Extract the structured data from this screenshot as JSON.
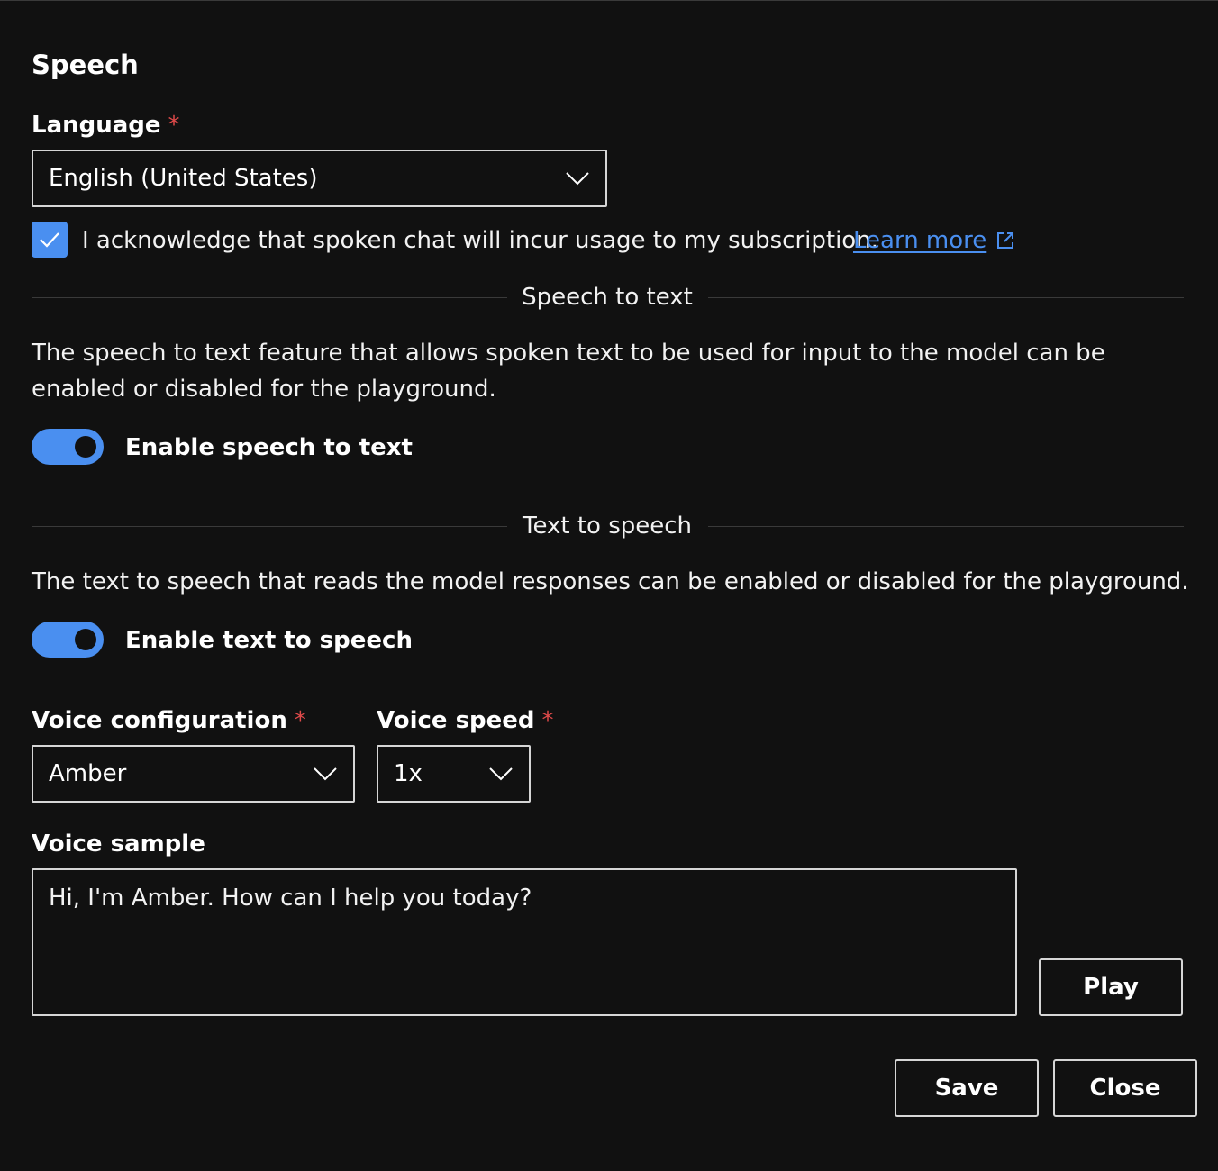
{
  "dialog": {
    "title": "Speech"
  },
  "language": {
    "label": "Language",
    "required_mark": "*",
    "selected": "English (United States)"
  },
  "acknowledge": {
    "checked": true,
    "text": "I acknowledge that spoken chat will incur usage to my subscription.",
    "link_text": "Learn more"
  },
  "speech_to_text": {
    "section_title": "Speech to text",
    "description": "The speech to text feature that allows spoken text to be used for input to the model can be enabled or disabled for the playground.",
    "toggle_label": "Enable speech to text",
    "enabled": true
  },
  "text_to_speech": {
    "section_title": "Text to speech",
    "description": "The text to speech that reads the model responses can be enabled or disabled for the playground.",
    "toggle_label": "Enable text to speech",
    "enabled": true
  },
  "voice_configuration": {
    "label": "Voice configuration",
    "required_mark": "*",
    "selected": "Amber"
  },
  "voice_speed": {
    "label": "Voice speed",
    "required_mark": "*",
    "selected": "1x"
  },
  "voice_sample": {
    "label": "Voice sample",
    "text": "Hi, I'm Amber. How can I help you today?",
    "play_label": "Play"
  },
  "footer": {
    "save_label": "Save",
    "close_label": "Close"
  },
  "colors": {
    "background": "#111111",
    "accent": "#4a8ff0",
    "required": "#e04a4a",
    "border": "#d6d6d6"
  }
}
